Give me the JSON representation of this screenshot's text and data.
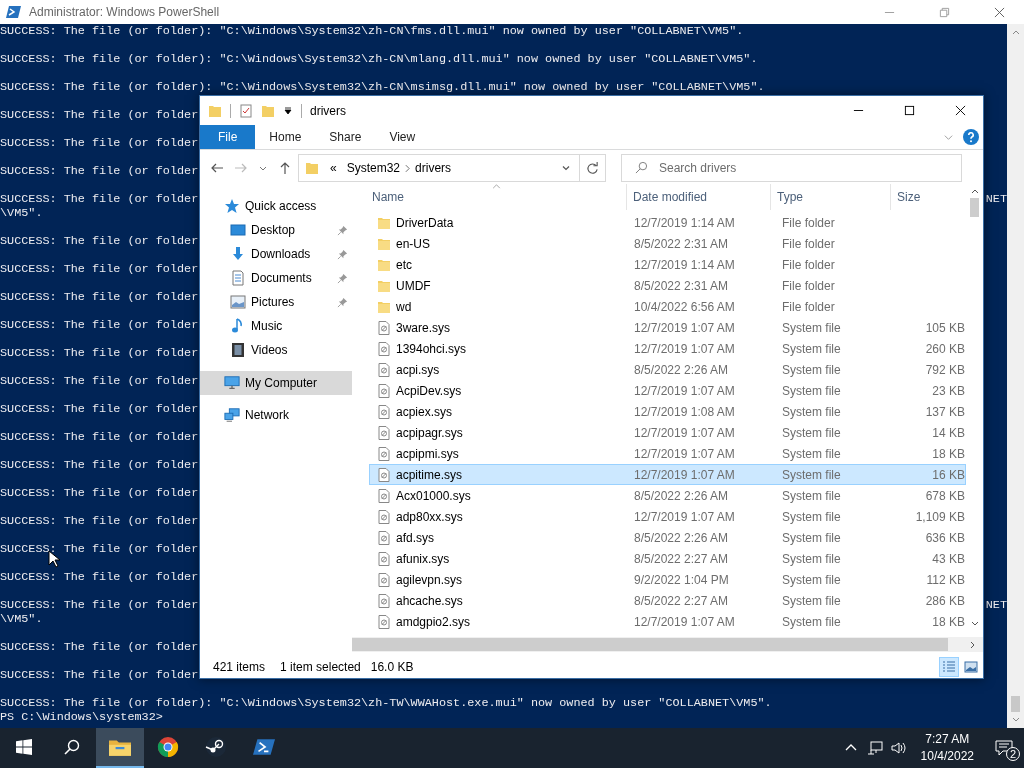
{
  "console": {
    "title": "Administrator: Windows PowerShell",
    "lines": [
      {
        "text": "SUCCESS: The file (or folder): \"C:\\Windows\\System32\\zh-CN\\fms.dll.mui\" now owned by user \"COLLABNET\\VM5\"."
      },
      {
        "text": "SUCCESS: The file (or folder): \"C:\\Windows\\System32\\zh-CN\\mlang.dll.mui\" now owned by user \"COLLABNET\\VM5\"."
      },
      {
        "text": "SUCCESS: The file (or folder): \"C:\\Windows\\System32\\zh-CN\\msimsg.dll.mui\" now owned by user \"COLLABNET\\VM5\"."
      },
      {
        "text": "SUCCESS: The file (or folder"
      },
      {
        "text": "SUCCESS: The file (or folder"
      },
      {
        "text": "SUCCESS: The file (or folder"
      },
      {
        "text": "SUCCESS: The file (or folder",
        "right": "NET",
        "wrap": "\\VM5\"."
      },
      {
        "text": "SUCCESS: The file (or folder"
      },
      {
        "text": "SUCCESS: The file (or folder"
      },
      {
        "text": "SUCCESS: The file (or folder"
      },
      {
        "text": "SUCCESS: The file (or folder"
      },
      {
        "text": "SUCCESS: The file (or folder"
      },
      {
        "text": "SUCCESS: The file (or folder"
      },
      {
        "text": "SUCCESS: The file (or folder"
      },
      {
        "text": "SUCCESS: The file (or folder"
      },
      {
        "text": "SUCCESS: The file (or folder"
      },
      {
        "text": "SUCCESS: The file (or folder"
      },
      {
        "text": "SUCCESS: The file (or folder"
      },
      {
        "text": "SUCCESS: The file (or folder"
      },
      {
        "text": "SUCCESS: The file (or folder"
      },
      {
        "text": "SUCCESS: The file (or folder",
        "right": "NET",
        "wrap": "\\VM5\"."
      },
      {
        "text": "SUCCESS: The file (or folder"
      },
      {
        "text": "SUCCESS: The file (or folder"
      },
      {
        "text": "SUCCESS: The file (or folder): \"C:\\Windows\\System32\\zh-TW\\WWAHost.exe.mui\" now owned by user \"COLLABNET\\VM5\"."
      }
    ],
    "prompt": "PS C:\\Windows\\system32>"
  },
  "explorer": {
    "title": "drivers",
    "ribbon_tabs": [
      {
        "label": "File",
        "selected": true
      },
      {
        "label": "Home",
        "selected": false
      },
      {
        "label": "Share",
        "selected": false
      },
      {
        "label": "View",
        "selected": false
      }
    ],
    "breadcrumb": [
      "«",
      "System32",
      "drivers"
    ],
    "search": {
      "placeholder": "Search drivers"
    },
    "nav": [
      {
        "label": "Quick access",
        "kind": "star",
        "selected": false,
        "children": [
          {
            "label": "Desktop",
            "kind": "desktop",
            "pinned": true,
            "selected": false
          },
          {
            "label": "Downloads",
            "kind": "download",
            "pinned": true,
            "selected": false
          },
          {
            "label": "Documents",
            "kind": "document",
            "pinned": true,
            "selected": false
          },
          {
            "label": "Pictures",
            "kind": "picture",
            "pinned": true,
            "selected": false
          },
          {
            "label": "Music",
            "kind": "music",
            "pinned": false,
            "selected": false
          },
          {
            "label": "Videos",
            "kind": "video",
            "pinned": false,
            "selected": false
          }
        ]
      },
      {
        "label": "My Computer",
        "kind": "computer",
        "selected": true
      },
      {
        "label": "Network",
        "kind": "network",
        "selected": false
      }
    ],
    "columns": [
      "Name",
      "Date modified",
      "Type",
      "Size"
    ],
    "files": [
      {
        "name": "DriverData",
        "date": "12/7/2019 1:14 AM",
        "type": "File folder",
        "kind": "folder",
        "selected": false
      },
      {
        "name": "en-US",
        "date": "8/5/2022 2:31 AM",
        "type": "File folder",
        "kind": "folder",
        "selected": false
      },
      {
        "name": "etc",
        "date": "12/7/2019 1:14 AM",
        "type": "File folder",
        "kind": "folder",
        "selected": false
      },
      {
        "name": "UMDF",
        "date": "8/5/2022 2:31 AM",
        "type": "File folder",
        "kind": "folder",
        "selected": false
      },
      {
        "name": "wd",
        "date": "10/4/2022 6:56 AM",
        "type": "File folder",
        "kind": "folder",
        "selected": false
      },
      {
        "name": "3ware.sys",
        "date": "12/7/2019 1:07 AM",
        "type": "System file",
        "size": "105 KB",
        "kind": "file",
        "selected": false
      },
      {
        "name": "1394ohci.sys",
        "date": "12/7/2019 1:07 AM",
        "type": "System file",
        "size": "260 KB",
        "kind": "file",
        "selected": false
      },
      {
        "name": "acpi.sys",
        "date": "8/5/2022 2:26 AM",
        "type": "System file",
        "size": "792 KB",
        "kind": "file",
        "selected": false
      },
      {
        "name": "AcpiDev.sys",
        "date": "12/7/2019 1:07 AM",
        "type": "System file",
        "size": "23 KB",
        "kind": "file",
        "selected": false
      },
      {
        "name": "acpiex.sys",
        "date": "12/7/2019 1:08 AM",
        "type": "System file",
        "size": "137 KB",
        "kind": "file",
        "selected": false
      },
      {
        "name": "acpipagr.sys",
        "date": "12/7/2019 1:07 AM",
        "type": "System file",
        "size": "14 KB",
        "kind": "file",
        "selected": false
      },
      {
        "name": "acpipmi.sys",
        "date": "12/7/2019 1:07 AM",
        "type": "System file",
        "size": "18 KB",
        "kind": "file",
        "selected": false
      },
      {
        "name": "acpitime.sys",
        "date": "12/7/2019 1:07 AM",
        "type": "System file",
        "size": "16 KB",
        "kind": "file",
        "selected": true
      },
      {
        "name": "Acx01000.sys",
        "date": "8/5/2022 2:26 AM",
        "type": "System file",
        "size": "678 KB",
        "kind": "file",
        "selected": false
      },
      {
        "name": "adp80xx.sys",
        "date": "12/7/2019 1:07 AM",
        "type": "System file",
        "size": "1,109 KB",
        "kind": "file",
        "selected": false
      },
      {
        "name": "afd.sys",
        "date": "8/5/2022 2:26 AM",
        "type": "System file",
        "size": "636 KB",
        "kind": "file",
        "selected": false
      },
      {
        "name": "afunix.sys",
        "date": "8/5/2022 2:27 AM",
        "type": "System file",
        "size": "43 KB",
        "kind": "file",
        "selected": false
      },
      {
        "name": "agilevpn.sys",
        "date": "9/2/2022 1:04 PM",
        "type": "System file",
        "size": "112 KB",
        "kind": "file",
        "selected": false
      },
      {
        "name": "ahcache.sys",
        "date": "8/5/2022 2:27 AM",
        "type": "System file",
        "size": "286 KB",
        "kind": "file",
        "selected": false
      },
      {
        "name": "amdgpio2.sys",
        "date": "12/7/2019 1:07 AM",
        "type": "System file",
        "size": "18 KB",
        "kind": "file",
        "selected": false
      }
    ],
    "status": {
      "count": "421 items",
      "selection": "1 item selected",
      "size": "16.0 KB"
    },
    "views": [
      {
        "kind": "details",
        "selected": true
      },
      {
        "kind": "tiles",
        "selected": false
      }
    ]
  },
  "taskbar": {
    "items": [
      {
        "kind": "start",
        "selected": false
      },
      {
        "kind": "search",
        "selected": false
      },
      {
        "kind": "explorer",
        "selected": true
      },
      {
        "kind": "chrome",
        "selected": false
      },
      {
        "kind": "steam",
        "selected": false
      },
      {
        "kind": "powershell",
        "selected": false
      }
    ],
    "time": "7:27 AM",
    "date": "10/4/2022",
    "notifications": "2"
  }
}
